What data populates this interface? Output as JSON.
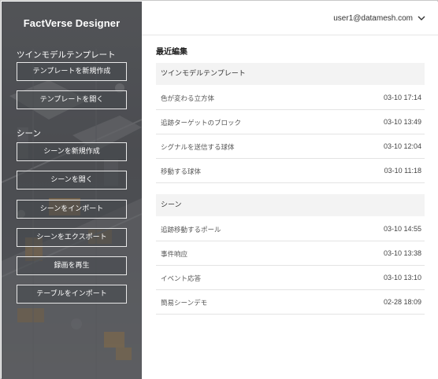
{
  "sidebar": {
    "app_title": "FactVerse Designer",
    "twin_section": {
      "label": "ツインモデルテンプレート",
      "buttons": [
        "テンプレートを新規作成",
        "テンプレートを開く"
      ]
    },
    "scene_section": {
      "label": "シーン",
      "buttons": [
        "シーンを新規作成",
        "シーンを開く",
        "シーンをインポート",
        "シーンをエクスポート",
        "録画を再生",
        "テーブルをインポート"
      ]
    }
  },
  "header": {
    "user_email": "user1@datamesh.com",
    "menu_icon": "chevron-down-icon"
  },
  "main": {
    "title": "最近編集",
    "groups": [
      {
        "heading": "ツインモデルテンプレート",
        "items": [
          {
            "name": "色が変わる立方体",
            "time": "03-10 17:14"
          },
          {
            "name": "追跡ターゲットのブロック",
            "time": "03-10 13:49"
          },
          {
            "name": "シグナルを送信する球体",
            "time": "03-10 12:04"
          },
          {
            "name": "移動する球体",
            "time": "03-10 11:18"
          }
        ]
      },
      {
        "heading": "シーン",
        "items": [
          {
            "name": "追跡移動するポール",
            "time": "03-10 14:55"
          },
          {
            "name": "事件响应",
            "time": "03-10 13:38"
          },
          {
            "name": "イベント応答",
            "time": "03-10 13:10"
          },
          {
            "name": "簡易シーンデモ",
            "time": "02-28 18:09"
          }
        ]
      }
    ]
  },
  "colors": {
    "sidebar_bg": "#55585c",
    "accent_orange": "#e8a23a",
    "group_head_bg": "#f3f3f3"
  }
}
